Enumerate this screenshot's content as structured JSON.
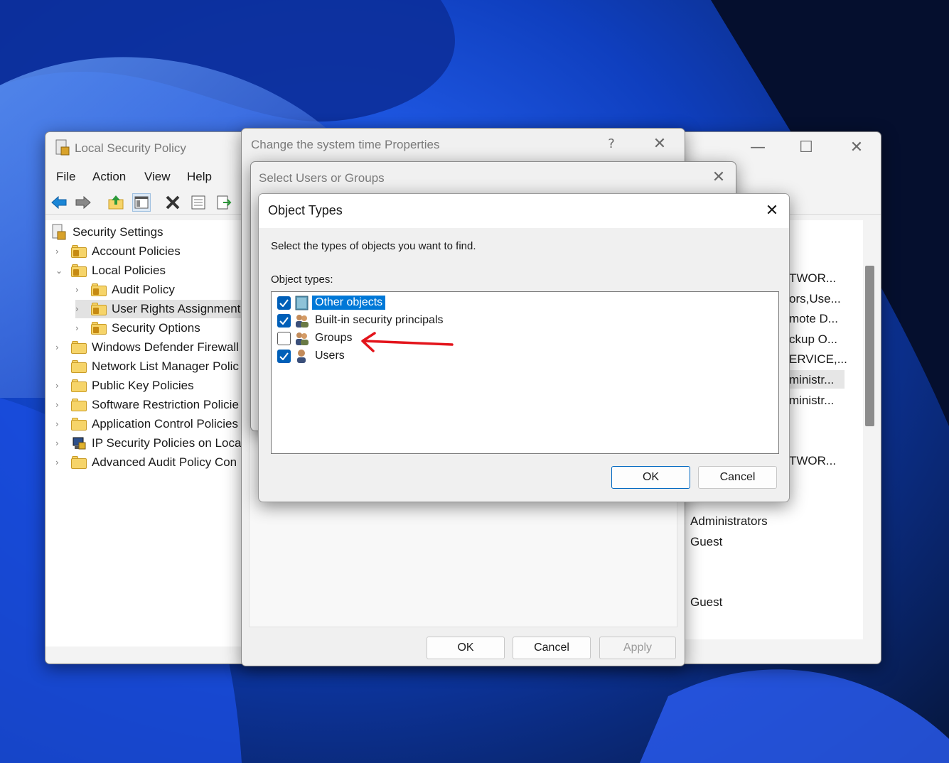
{
  "lsp": {
    "title": "Local Security Policy",
    "menu": [
      "File",
      "Action",
      "View",
      "Help"
    ],
    "tree": [
      {
        "label": "Security Settings",
        "level": 0
      },
      {
        "label": "Account Policies",
        "level": 1
      },
      {
        "label": "Local Policies",
        "level": 1
      },
      {
        "label": "Audit Policy",
        "level": 2
      },
      {
        "label": "User Rights Assignment",
        "level": 2
      },
      {
        "label": "Security Options",
        "level": 2
      },
      {
        "label": "Windows Defender Firewall",
        "level": 1
      },
      {
        "label": "Network List Manager Polic",
        "level": 1
      },
      {
        "label": "Public Key Policies",
        "level": 1
      },
      {
        "label": "Software Restriction Policie",
        "level": 1
      },
      {
        "label": "Application Control Policies",
        "level": 1
      },
      {
        "label": "IP Security Policies on Local",
        "level": 1
      },
      {
        "label": "Advanced Audit Policy Con",
        "level": 1
      }
    ],
    "right_values": [
      "TWOR...",
      "ors,Use...",
      "mote D...",
      "ckup O...",
      "ERVICE,...",
      "ministr...",
      "ministr...",
      "TWOR...",
      "Administrators",
      "Guest",
      "Guest"
    ]
  },
  "props": {
    "title": "Change the system time Properties",
    "help": "?",
    "ok": "OK",
    "cancel": "Cancel",
    "apply": "Apply"
  },
  "selusers": {
    "title": "Select Users or Groups"
  },
  "objtypes": {
    "title": "Object Types",
    "instruction": "Select the types of objects you want to find.",
    "list_label": "Object types:",
    "items": [
      {
        "label": "Other objects",
        "checked": true,
        "selected": true
      },
      {
        "label": "Built-in security principals",
        "checked": true,
        "selected": false
      },
      {
        "label": "Groups",
        "checked": false,
        "selected": false
      },
      {
        "label": "Users",
        "checked": true,
        "selected": false
      }
    ],
    "ok": "OK",
    "cancel": "Cancel"
  },
  "colors": {
    "accent": "#005fb8",
    "selection": "#0078d7",
    "annotation_arrow": "#e3141b"
  }
}
